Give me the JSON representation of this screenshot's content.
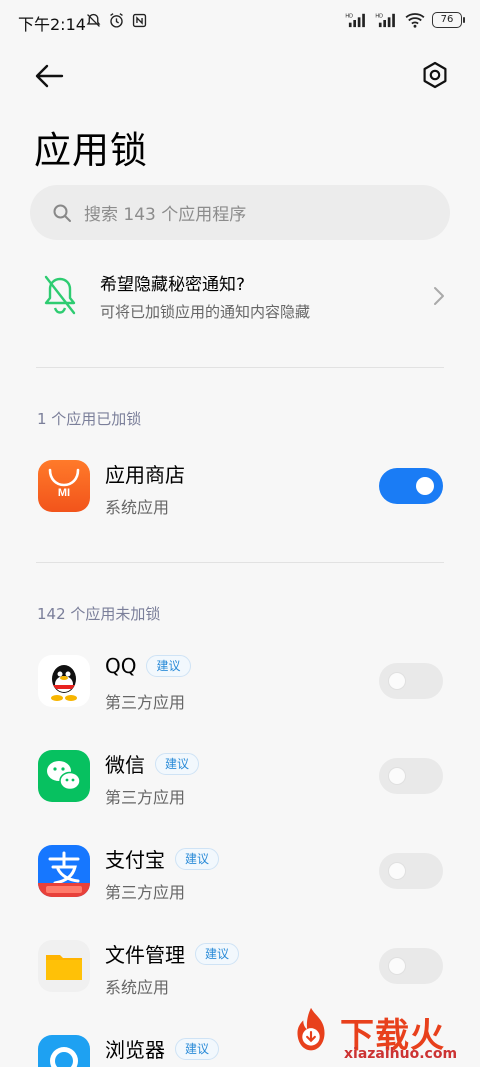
{
  "status_bar": {
    "time": "下午2:14",
    "battery": "76",
    "icons": [
      "mute-icon",
      "alarm-icon",
      "nfc-icon",
      "signal-hd-icon",
      "signal-hd-icon",
      "wifi-icon",
      "battery-icon"
    ]
  },
  "header": {
    "title": "应用锁",
    "icons": [
      "back-arrow-icon",
      "settings-icon"
    ]
  },
  "search": {
    "placeholder": "搜索 143 个应用程序"
  },
  "notice": {
    "title": "希望隐藏秘密通知?",
    "subtitle": "可将已加锁应用的通知内容隐藏"
  },
  "locked_section": {
    "label": "1 个应用已加锁",
    "apps": [
      {
        "name": "应用商店",
        "type": "系统应用",
        "locked": true,
        "icon": "mi-store-icon"
      }
    ]
  },
  "unlocked_section": {
    "label": "142 个应用未加锁",
    "apps": [
      {
        "name": "QQ",
        "badge": "建议",
        "type": "第三方应用",
        "locked": false,
        "icon": "qq-icon"
      },
      {
        "name": "微信",
        "badge": "建议",
        "type": "第三方应用",
        "locked": false,
        "icon": "wechat-icon"
      },
      {
        "name": "支付宝",
        "badge": "建议",
        "type": "第三方应用",
        "locked": false,
        "icon": "alipay-icon"
      },
      {
        "name": "文件管理",
        "badge": "建议",
        "type": "系统应用",
        "locked": false,
        "icon": "file-manager-icon"
      },
      {
        "name": "浏览器",
        "badge": "建议",
        "type": "",
        "locked": false,
        "icon": "browser-icon"
      }
    ]
  },
  "watermark": {
    "brand": "下载火",
    "url": "xiazaihuo.com"
  },
  "colors": {
    "accent": "#1a7cf5",
    "notice_green": "#2ecc71",
    "badge_blue": "#2a8bd8",
    "watermark_red": "#e8401c"
  }
}
